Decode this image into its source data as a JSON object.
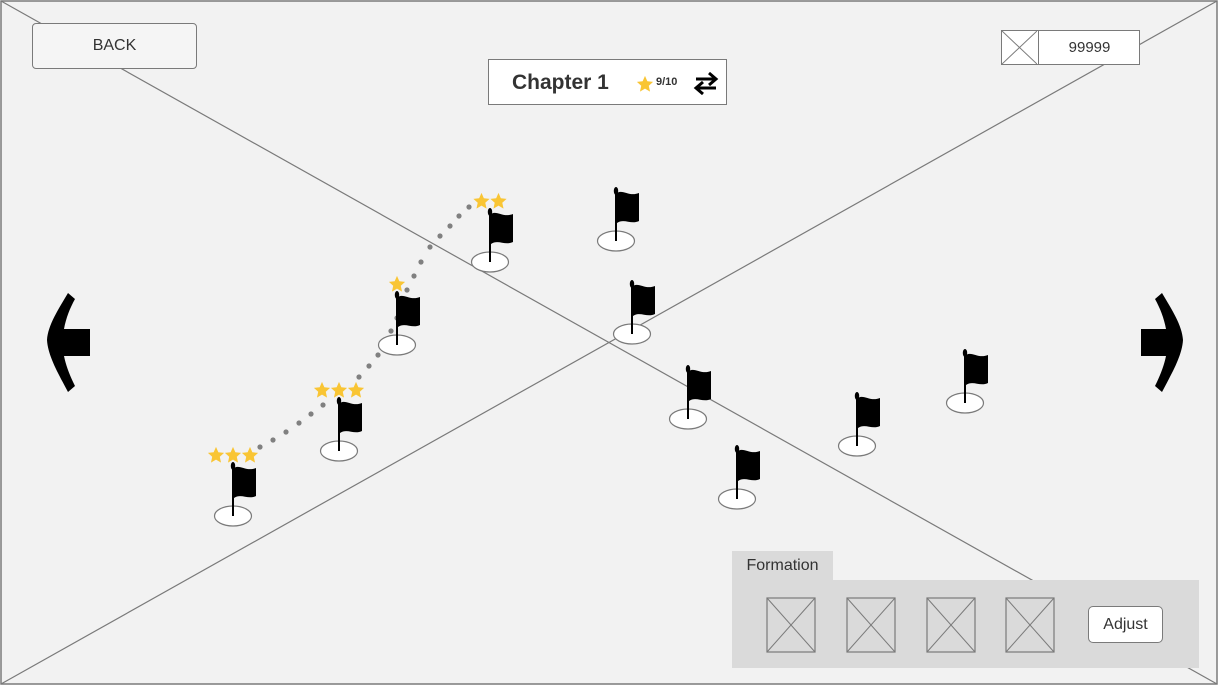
{
  "header": {
    "back_label": "BACK",
    "chapter_title": "Chapter 1",
    "stars_progress": "9/10",
    "currency_value": "99999",
    "currency_icon": "image-placeholder-icon",
    "swap_icon": "swap-arrows-icon"
  },
  "map": {
    "nodes": [
      {
        "id": 1,
        "stars": 3
      },
      {
        "id": 2,
        "stars": 3
      },
      {
        "id": 3,
        "stars": 1
      },
      {
        "id": 4,
        "stars": 2
      },
      {
        "id": 5,
        "stars": 0
      },
      {
        "id": 6,
        "stars": 0
      },
      {
        "id": 7,
        "stars": 0
      },
      {
        "id": 8,
        "stars": 0
      },
      {
        "id": 9,
        "stars": 0
      },
      {
        "id": 10,
        "stars": 0
      }
    ],
    "nav": {
      "prev_icon": "arrow-left-icon",
      "next_icon": "arrow-right-icon"
    }
  },
  "formation": {
    "tab_label": "Formation",
    "slot_count": 4,
    "adjust_label": "Adjust"
  },
  "colors": {
    "background": "#f2f2f2",
    "frame_line": "#7a7a7a",
    "star": "#f9c534",
    "panel": "#dadada",
    "path_dot": "#808080",
    "flag": "#000000"
  }
}
